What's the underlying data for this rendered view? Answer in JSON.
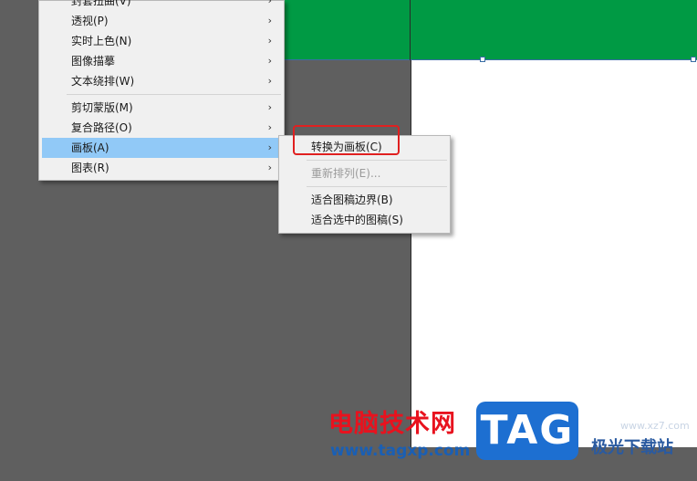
{
  "main_menu": {
    "items": [
      {
        "label": "封套扭曲(V)",
        "submenu": true
      },
      {
        "label": "透视(P)",
        "submenu": true
      },
      {
        "label": "实时上色(N)",
        "submenu": true
      },
      {
        "label": "图像描摹",
        "submenu": true
      },
      {
        "label": "文本绕排(W)",
        "submenu": true
      },
      {
        "label": "剪切蒙版(M)",
        "submenu": true
      },
      {
        "label": "复合路径(O)",
        "submenu": true
      },
      {
        "label": "画板(A)",
        "submenu": true,
        "highlighted": true
      },
      {
        "label": "图表(R)",
        "submenu": true
      }
    ],
    "arrow_glyph": "›"
  },
  "sub_menu": {
    "items": [
      {
        "label": "转换为画板(C)",
        "enabled": true
      },
      {
        "label": "重新排列(E)...",
        "enabled": false
      },
      {
        "label": "适合图稿边界(B)",
        "enabled": true
      },
      {
        "label": "适合选中的图稿(S)",
        "enabled": true
      }
    ]
  },
  "watermark": {
    "site_name": "电脑技术网",
    "url": "www.tagxp.com",
    "logo_text": "TAG",
    "right_text": "极光下载站",
    "right_sub": "www.xz7.com"
  },
  "colors": {
    "canvas": "#5f5f5f",
    "green_shape": "#009a44",
    "highlight": "#91c9f7",
    "annotation_red": "#e02020"
  }
}
